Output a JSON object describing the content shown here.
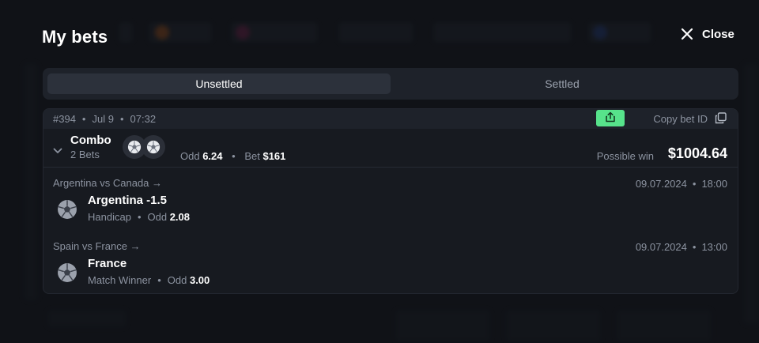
{
  "modal": {
    "title": "My bets",
    "close_label": "Close"
  },
  "tabs": [
    {
      "label": "Unsettled",
      "active": true
    },
    {
      "label": "Settled",
      "active": false
    }
  ],
  "bet": {
    "id": "#394",
    "date": "Jul 9",
    "time": "07:32",
    "copy_label": "Copy bet ID",
    "type": "Combo",
    "count": "2 Bets",
    "odd_label": "Odd",
    "odd": "6.24",
    "bet_label": "Bet",
    "stake": "$161",
    "possible_win_label": "Possible win",
    "possible_win": "$1004.64",
    "selections": [
      {
        "match": "Argentina vs Canada",
        "datetime_date": "09.07.2024",
        "datetime_time": "18:00",
        "pick": "Argentina -1.5",
        "market": "Handicap",
        "odd_label": "Odd",
        "odd": "2.08"
      },
      {
        "match": "Spain vs France",
        "datetime_date": "09.07.2024",
        "datetime_time": "13:00",
        "pick": "France",
        "market": "Match Winner",
        "odd_label": "Odd",
        "odd": "3.00"
      }
    ]
  },
  "colors": {
    "accent_green": "#57e38b",
    "panel": "#171a20",
    "muted_text": "#8c93a0"
  },
  "icons": {
    "close": "close-icon",
    "share": "share-icon",
    "copy": "copy-icon",
    "chevron": "chevron-down-icon",
    "sport": "soccer-ball-icon"
  }
}
